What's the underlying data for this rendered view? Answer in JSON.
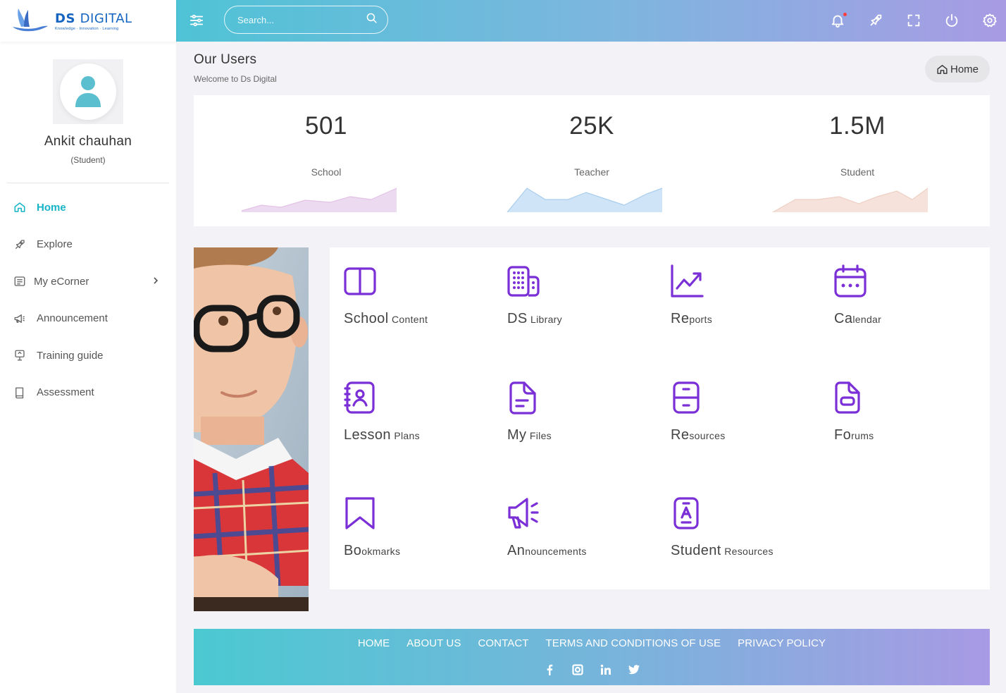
{
  "brand": {
    "name_bold": "DS ",
    "name_thin": "DIGITAL",
    "tagline": "Knowledge · Innovation · Learning"
  },
  "topbar": {
    "search_placeholder": "Search...",
    "icons": [
      "settings-sliders-icon",
      "search-icon",
      "bell-icon",
      "rocket-icon",
      "fullscreen-icon",
      "power-icon",
      "gear-icon"
    ],
    "notification_dot_color": "#ff3d3d"
  },
  "profile": {
    "name": "Ankit chauhan",
    "role": "(Student)"
  },
  "sidebar": {
    "items": [
      {
        "label": "Home",
        "icon": "home-icon",
        "active": true
      },
      {
        "label": "Explore",
        "icon": "rocket-icon"
      },
      {
        "label": "My eCorner",
        "icon": "list-icon",
        "has_submenu": true
      },
      {
        "label": "Announcement",
        "icon": "megaphone-icon"
      },
      {
        "label": "Training guide",
        "icon": "presentation-icon"
      },
      {
        "label": "Assessment",
        "icon": "book-icon"
      }
    ]
  },
  "page": {
    "title": "Our Users",
    "subtitle": "Welcome to Ds Digital",
    "breadcrumb": "Home"
  },
  "stats": [
    {
      "value": "501",
      "label": "School",
      "color": "#e9c4e6"
    },
    {
      "value": "25K",
      "label": "Teacher",
      "color": "#b9d9f3"
    },
    {
      "value": "1.5M",
      "label": "Student",
      "color": "#f4d8cc"
    }
  ],
  "tiles": [
    {
      "big": "School",
      "small": "Content",
      "icon": "open-book-icon"
    },
    {
      "big": "DS",
      "small": "Library",
      "icon": "building-icon"
    },
    {
      "big": "Re",
      "small": "ports",
      "icon": "trending-chart-icon"
    },
    {
      "big": "Ca",
      "small": "lendar",
      "icon": "calendar-icon"
    },
    {
      "big": "Lesson",
      "small": "Plans",
      "icon": "contact-book-icon"
    },
    {
      "big": "My",
      "small": "Files",
      "icon": "document-icon"
    },
    {
      "big": "Re",
      "small": "sources",
      "icon": "device-icon"
    },
    {
      "big": "Fo",
      "small": "rums",
      "icon": "forum-doc-icon"
    },
    {
      "big": "Bo",
      "small": "okmarks",
      "icon": "bookmark-icon"
    },
    {
      "big": "An",
      "small": "nouncements",
      "icon": "megaphone-icon"
    },
    {
      "big": "Student",
      "small": "Resources",
      "icon": "student-tablet-icon"
    }
  ],
  "accent": {
    "primary": "#17b3c7",
    "tile_icon": "#7b2fd6"
  },
  "footer": {
    "links": [
      "HOME",
      "ABOUT US",
      "CONTACT",
      "TERMS AND CONDITIONS OF USE",
      "PRIVACY POLICY"
    ],
    "social": [
      "facebook-icon",
      "instagram-icon",
      "linkedin-icon",
      "twitter-icon"
    ]
  }
}
